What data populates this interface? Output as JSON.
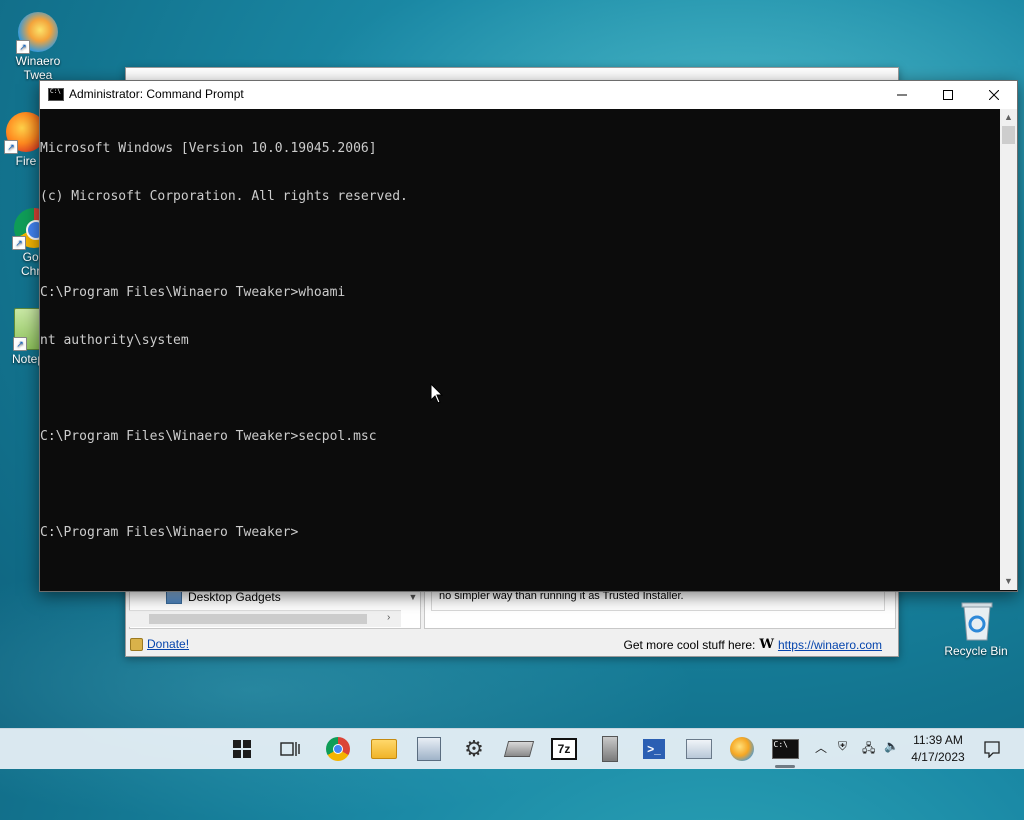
{
  "desktop": {
    "icons": [
      {
        "label": "Winaero\nTwea",
        "name": "winaero-tweaker"
      },
      {
        "label": "Fire",
        "name": "firefox"
      },
      {
        "label": "Goo\nChro",
        "name": "google-chrome"
      },
      {
        "label": "Notep",
        "name": "notepad"
      }
    ],
    "recycle_bin": "Recycle Bin"
  },
  "tweaker": {
    "tree_item": "Desktop Gadgets",
    "description": "no simpler way than running it as Trusted Installer.",
    "donate": "Donate!",
    "cool_stuff": "Get more cool stuff here:",
    "logo": "W",
    "site_link": "https://winaero.com"
  },
  "cmd": {
    "title": "Administrator: Command Prompt",
    "lines": [
      "Microsoft Windows [Version 10.0.19045.2006]",
      "(c) Microsoft Corporation. All rights reserved.",
      "",
      "C:\\Program Files\\Winaero Tweaker>whoami",
      "nt authority\\system",
      "",
      "C:\\Program Files\\Winaero Tweaker>secpol.msc",
      "",
      "C:\\Program Files\\Winaero Tweaker>"
    ]
  },
  "taskbar": {
    "apps": [
      "start",
      "task-view",
      "chrome",
      "file-explorer",
      "tweaker",
      "settings",
      "network",
      "7zip",
      "registry",
      "powershell",
      "control-panel",
      "firefox",
      "command-prompt"
    ],
    "clock_time": "11:39 AM",
    "clock_date": "4/17/2023"
  },
  "colors": {
    "console_bg": "#0c0c0c",
    "console_fg": "#cccccc",
    "taskbar_bg": "#e1ecf4",
    "link": "#0645ad"
  }
}
